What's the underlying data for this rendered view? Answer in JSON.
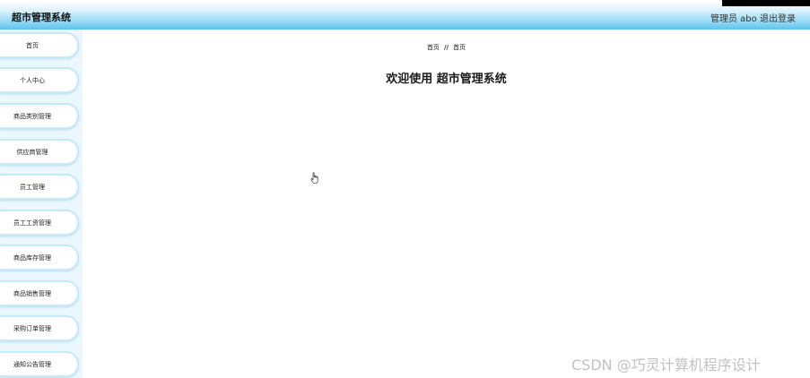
{
  "header": {
    "app_title": "超市管理系统",
    "user_label": "管理员 abo",
    "logout_label": "退出登录"
  },
  "sidebar": {
    "items": [
      {
        "label": "首页"
      },
      {
        "label": "个人中心"
      },
      {
        "label": "商品类别管理"
      },
      {
        "label": "供应商管理"
      },
      {
        "label": "员工管理"
      },
      {
        "label": "员工工资管理"
      },
      {
        "label": "商品库存管理"
      },
      {
        "label": "商品销售管理"
      },
      {
        "label": "采购订单管理"
      },
      {
        "label": "通知公告管理"
      }
    ]
  },
  "main": {
    "breadcrumb": {
      "home": "首页",
      "separator": "//",
      "current": "首页"
    },
    "welcome_text": "欢迎使用 超市管理系统"
  },
  "watermark": "CSDN @巧灵计算机程序设计",
  "colors": {
    "header_gradient_end": "#5ec3ee",
    "sidebar_bg": "#eaf7fd",
    "sidebar_item_border": "#c7e9f8"
  }
}
